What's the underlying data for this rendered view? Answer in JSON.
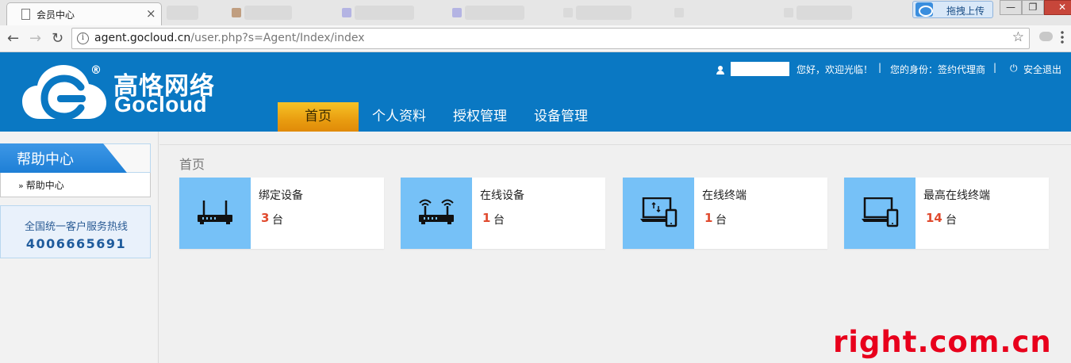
{
  "browser": {
    "tab_title": "会员中心",
    "tab_close": "×",
    "upload_button": "拖拽上传",
    "window_controls": {
      "minimize": "—",
      "restore": "❐",
      "close": "✕"
    },
    "url_host": "agent.gocloud.cn",
    "url_path": "/user.php?s=Agent/Index/index"
  },
  "header": {
    "brand_cn": "高恪网络",
    "brand_en": "Gocloud",
    "reg_mark": "®",
    "welcome": "您好，欢迎光临！",
    "identity": "您的身份：签约代理商",
    "logout": "安全退出",
    "separator": "|",
    "nav": [
      "首页",
      "个人资料",
      "授权管理",
      "设备管理"
    ],
    "accent_color": "#0a78c3",
    "active_nav_color": "#f0ae1a"
  },
  "sidebar": {
    "help_title": "帮助中心",
    "help_chevron": "»",
    "help_items": [
      "帮助中心"
    ],
    "hotline_label": "全国统一客户服务热线",
    "hotline_number": "4006665691"
  },
  "main": {
    "breadcrumb": "首页",
    "cards": [
      {
        "label": "绑定设备",
        "value": "3",
        "unit": "台",
        "icon": "router-icon"
      },
      {
        "label": "在线设备",
        "value": "1",
        "unit": "台",
        "icon": "wifi-router-icon"
      },
      {
        "label": "在线终端",
        "value": "1",
        "unit": "台",
        "icon": "laptop-phone-sync-icon"
      },
      {
        "label": "最高在线终端",
        "value": "14",
        "unit": "台",
        "icon": "laptop-phone-icon"
      }
    ]
  },
  "watermark": "right.com.cn"
}
